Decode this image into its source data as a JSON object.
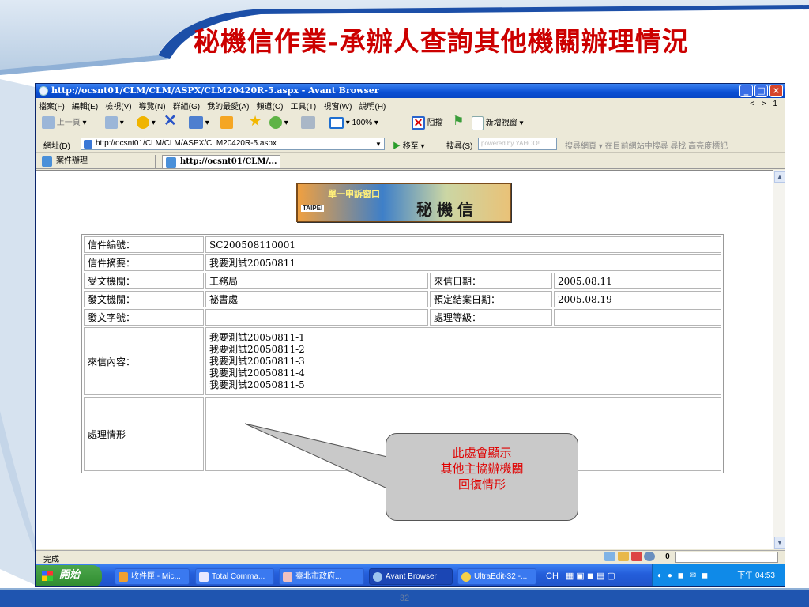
{
  "slide": {
    "title": "秘機信作業-承辦人查詢其他機關辦理情況",
    "page_number": "32"
  },
  "window": {
    "title": "http://ocsnt01/CLM/CLM/ASPX/CLM20420R-5.aspx - Avant Browser",
    "buttons": [
      "_",
      "□",
      "×"
    ]
  },
  "menu": {
    "items": [
      "檔案(F)",
      "編輯(E)",
      "檢視(V)",
      "導覽(N)",
      "群組(G)",
      "我的最愛(A)",
      "頻道(C)",
      "工具(T)",
      "視窗(W)",
      "說明(H)"
    ],
    "right_controls": "< > 1"
  },
  "toolbar": {
    "back": "上一頁",
    "zoom": "100%",
    "block": "阻擋",
    "new_window": "新增視窗"
  },
  "address_bar": {
    "label": "網址(D)",
    "url": "http://ocsnt01/CLM/CLM/ASPX/CLM20420R-5.aspx",
    "go": "移至",
    "search_label": "搜尋(S)",
    "search_placeholder": "powered by YAHOO!",
    "search_extra": "搜尋網頁 ▾  在目前網站中搜尋  尋找  高亮度標記"
  },
  "tabs": [
    {
      "label": "案件辦理"
    },
    {
      "label": "http://ocsnt01/CLM/..."
    }
  ],
  "banner": {
    "line1": "單一申訴窗口",
    "taipei": "TAIPEI",
    "name": "秘機信"
  },
  "form": {
    "letter_no_label": "信件編號：",
    "letter_no": "SC200508110001",
    "summary_label": "信件摘要：",
    "summary": "我要測試20050811",
    "receiving_agency_label": "受文機關：",
    "receiving_agency": "工務局",
    "received_date_label": "來信日期：",
    "received_date": "2005.08.11",
    "sending_agency_label": "發文機關：",
    "sending_agency": "祕書處",
    "due_date_label": "預定結案日期：",
    "due_date": "2005.08.19",
    "doc_no_label": "發文字號：",
    "doc_no": "",
    "priority_label": "處理等級：",
    "priority": "",
    "content_label": "來信內容：",
    "content_lines": [
      "我要測試20050811-1",
      "我要測試20050811-2",
      "我要測試20050811-3",
      "我要測試20050811-4",
      "我要測試20050811-5"
    ],
    "handling_label": "處理情形",
    "handling": ""
  },
  "callout": {
    "lines": [
      "此處會顯示",
      "其他主協辦機關",
      "回復情形"
    ]
  },
  "status": {
    "text": "完成",
    "count": "0"
  },
  "taskbar": {
    "start": "開始",
    "tasks": [
      "收件匣 - Mic...",
      "Total Comma...",
      "臺北市政府...",
      "Avant Browser",
      "UltraEdit-32 -..."
    ],
    "ime": "CH",
    "clock": "下午 04:53"
  },
  "colors": {
    "title_red": "#cc0000",
    "callout_text": "#e00000",
    "xp_blue": "#245edb"
  }
}
